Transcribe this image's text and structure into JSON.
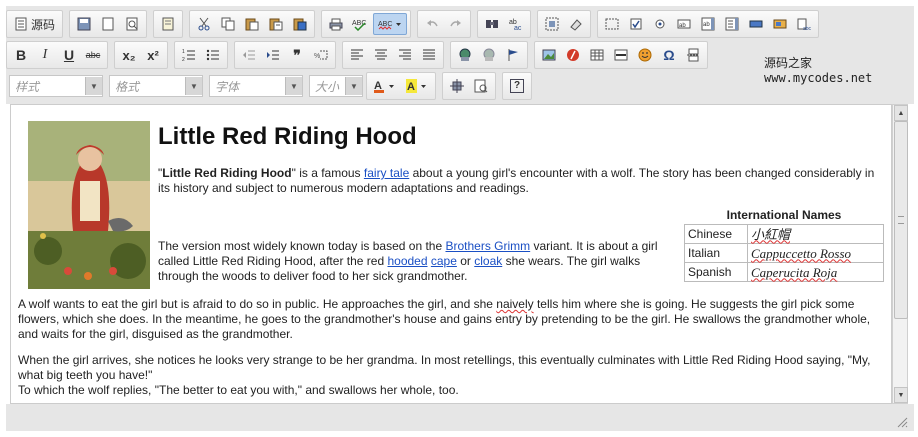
{
  "toolbar": {
    "row1": {
      "source_label": "源码",
      "items": [
        "document-icon",
        "save-icon",
        "new-page-icon",
        "preview-icon",
        "templates-icon",
        "cut-icon",
        "copy-icon",
        "paste-icon",
        "paste-text-icon",
        "paste-word-icon",
        "print-icon",
        "spellcheck-icon",
        "spellcheck-as-you-type-icon",
        "undo-icon",
        "redo-icon",
        "find-icon",
        "replace-icon",
        "select-all-icon",
        "remove-format-icon",
        "form-icon",
        "checkbox-icon",
        "radio-icon",
        "textfield-icon",
        "textarea-icon",
        "select-field-icon",
        "button-field-icon",
        "image-button-icon",
        "hidden-field-icon"
      ]
    },
    "row2": {
      "bold": "B",
      "italic": "I",
      "underline": "U",
      "strike": "abc",
      "subscript": "x₂",
      "superscript": "x²",
      "blockquote": "❞"
    },
    "row3": {
      "style_placeholder": "样式",
      "format_placeholder": "格式",
      "font_placeholder": "字体",
      "size_placeholder": "大小",
      "about": "?"
    },
    "site_label": "源码之家www.mycodes.net"
  },
  "document": {
    "title": "Little Red Riding Hood",
    "p1": {
      "quote_open": "\"",
      "bold_name": "Little Red Riding Hood",
      "quote_close": "\"",
      "before_link": " is a famous ",
      "link": "fairy tale",
      "after_link": " about a young girl's encounter with a wolf. The story has been changed considerably in its history and subject to numerous modern adaptations and readings."
    },
    "p2": {
      "t1": "The version most widely known today is based on the ",
      "link1": "Brothers Grimm",
      "t2": " variant. It is about a girl called Little Red Riding Hood, after the red ",
      "link2": "hooded",
      "t3": " ",
      "link3": "cape",
      "t4": " or ",
      "link4": "cloak",
      "t5": " she wears. The girl walks through the woods to deliver food to her sick grandmother."
    },
    "p3": {
      "t1": "A wolf wants to eat the girl but is afraid to do so in public. He approaches the girl, and she ",
      "naively": "naively",
      "t2": " tells him where she is going. He suggests the girl pick some flowers, which she does. In the meantime, he goes to the grandmother's house and gains entry by pretending to be the girl. He swallows the grandmother whole, and waits for the girl, disguised as the grandmother."
    },
    "p4": "When the girl arrives, she notices he looks very strange to be her grandma. In most retellings, this eventually culminates with Little Red Riding Hood saying, \"My, what big teeth you have!\"",
    "p5": "To which the wolf replies, \"The better to eat you with,\" and swallows her whole, too.",
    "names_table": {
      "caption": "International Names",
      "rows": [
        {
          "lang": "Chinese",
          "name": "小紅帽"
        },
        {
          "lang": "Italian",
          "name": "Cappuccetto Rosso"
        },
        {
          "lang": "Spanish",
          "name": "Caperucita Roja"
        }
      ]
    }
  }
}
